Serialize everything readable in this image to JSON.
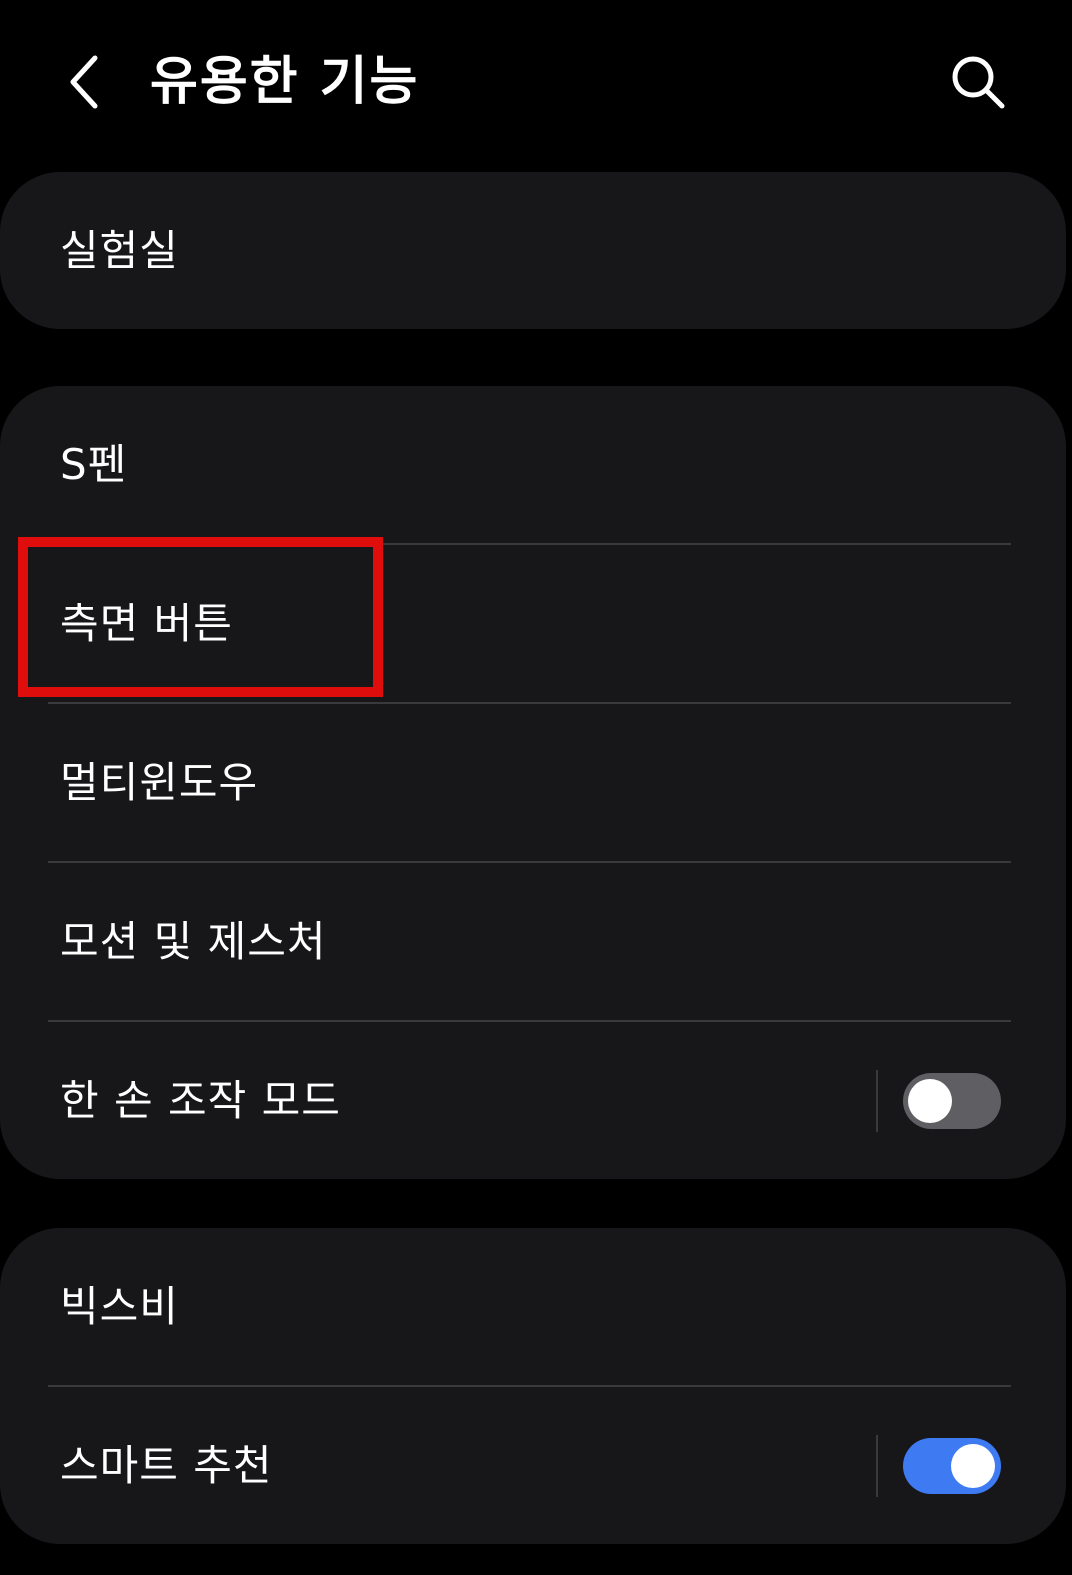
{
  "header": {
    "title": "유용한 기능",
    "back_icon": "chevron-left-icon",
    "search_icon": "search-icon"
  },
  "cards": [
    {
      "items": [
        {
          "label": "실험실"
        }
      ]
    },
    {
      "items": [
        {
          "label": "S펜"
        },
        {
          "label": "측면 버튼"
        },
        {
          "label": "멀티윈도우"
        },
        {
          "label": "모션 및 제스처"
        },
        {
          "label": "한 손 조작 모드",
          "toggle": false
        }
      ]
    },
    {
      "items": [
        {
          "label": "빅스비"
        },
        {
          "label": "스마트 추천",
          "toggle": true
        }
      ]
    }
  ],
  "colors": {
    "background": "#000000",
    "card": "#17171a",
    "divider": "#3a3a3d",
    "toggle_on": "#3e7bf2",
    "toggle_off": "#5e5e63",
    "highlight": "#e00d0d"
  }
}
